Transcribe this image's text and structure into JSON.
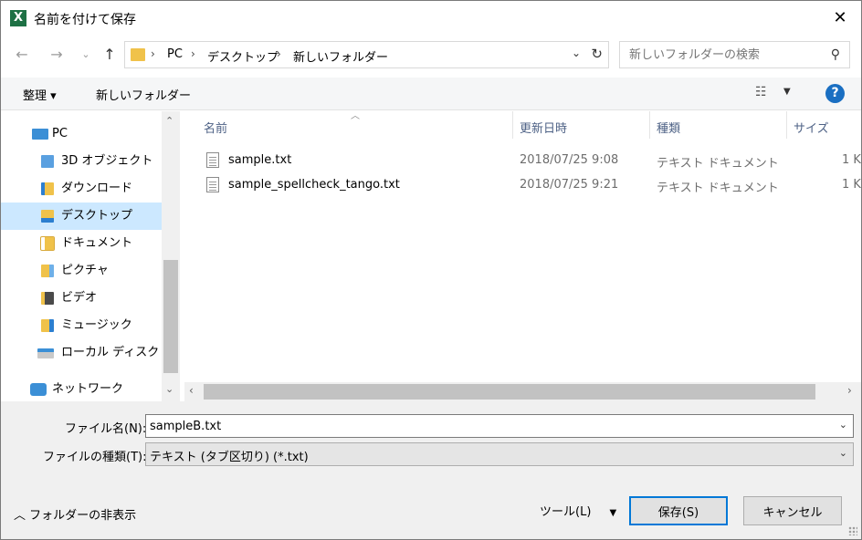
{
  "window": {
    "title": "名前を付けて保存",
    "app_icon": "X",
    "accent": "#0078d7",
    "excel_green": "#1e7145"
  },
  "address": {
    "crumbs": [
      "PC",
      "デスクトップ",
      "新しいフォルダー"
    ]
  },
  "search": {
    "placeholder": "新しいフォルダーの検索"
  },
  "toolbar": {
    "organize": "整理 ▾",
    "new_folder": "新しいフォルダー",
    "help": "?"
  },
  "nav": {
    "items": [
      {
        "label": "PC"
      },
      {
        "label": "3D オブジェクト"
      },
      {
        "label": "ダウンロード"
      },
      {
        "label": "デスクトップ",
        "selected": true
      },
      {
        "label": "ドキュメント"
      },
      {
        "label": "ピクチャ"
      },
      {
        "label": "ビデオ"
      },
      {
        "label": "ミュージック"
      },
      {
        "label": "ローカル ディスク (C"
      },
      {
        "label": "ネットワーク"
      }
    ]
  },
  "filelist": {
    "columns": [
      "名前",
      "更新日時",
      "種類",
      "サイズ"
    ],
    "rows": [
      {
        "name": "sample.txt",
        "date": "2018/07/25 9:08",
        "type": "テキスト ドキュメント",
        "size": "1 K"
      },
      {
        "name": "sample_spellcheck_tango.txt",
        "date": "2018/07/25 9:21",
        "type": "テキスト ドキュメント",
        "size": "1 K"
      }
    ]
  },
  "form": {
    "filename_label": "ファイル名(N):",
    "filename_value": "sampleB.txt",
    "filetype_label": "ファイルの種類(T):",
    "filetype_value": "テキスト (タブ区切り) (*.txt)",
    "hide_folders": "フォルダーの非表示",
    "tools": "ツール(L)",
    "save": "保存(S)",
    "cancel": "キャンセル"
  }
}
